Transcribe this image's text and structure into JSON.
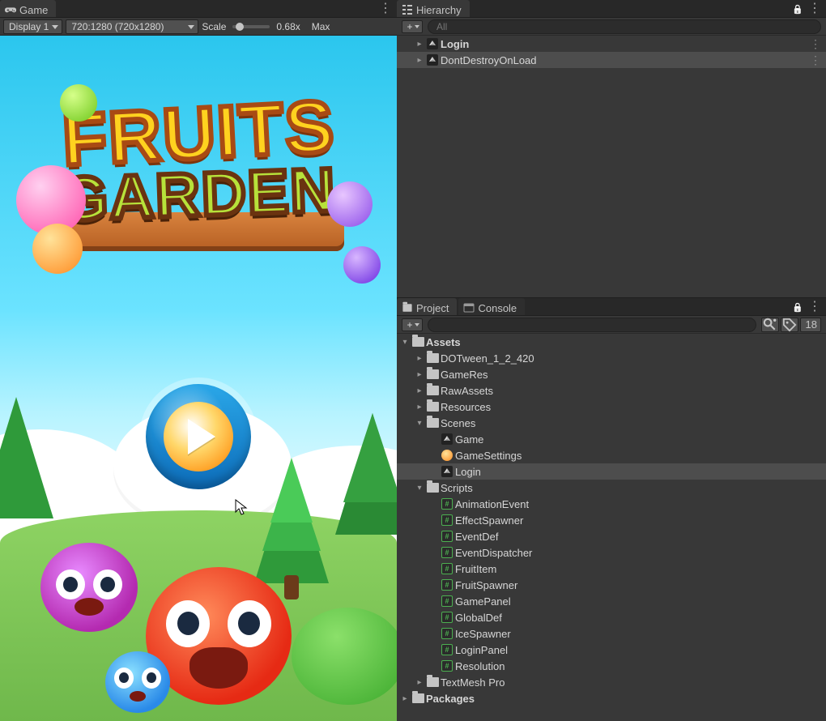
{
  "game_panel": {
    "tab_label": "Game",
    "display_dropdown": "Display 1",
    "resolution_dropdown": "720:1280 (720x1280)",
    "scale_label": "Scale",
    "scale_value": "0.68x",
    "max_label": "Max",
    "logo_line1": "FRUITS",
    "logo_line2": "GARDEN"
  },
  "hierarchy_panel": {
    "tab_label": "Hierarchy",
    "search_placeholder": "All",
    "items": [
      {
        "label": "Login",
        "bold": true
      },
      {
        "label": "DontDestroyOnLoad",
        "bold": false
      }
    ]
  },
  "project_panel": {
    "tab_project": "Project",
    "tab_console": "Console",
    "search_placeholder": "",
    "hidden_count": "18",
    "tree": {
      "assets": "Assets",
      "dotween": "DOTween_1_2_420",
      "gameres": "GameRes",
      "rawassets": "RawAssets",
      "resources": "Resources",
      "scenes": "Scenes",
      "scene_game": "Game",
      "scene_gamesettings": "GameSettings",
      "scene_login": "Login",
      "scripts": "Scripts",
      "s_animationevent": "AnimationEvent",
      "s_effectspawner": "EffectSpawner",
      "s_eventdef": "EventDef",
      "s_eventdispatcher": "EventDispatcher",
      "s_fruititem": "FruitItem",
      "s_fruitspawner": "FruitSpawner",
      "s_gamepanel": "GamePanel",
      "s_globaldef": "GlobalDef",
      "s_icespawner": "IceSpawner",
      "s_loginpanel": "LoginPanel",
      "s_resolution": "Resolution",
      "textmeshpro": "TextMesh Pro",
      "packages": "Packages"
    }
  }
}
